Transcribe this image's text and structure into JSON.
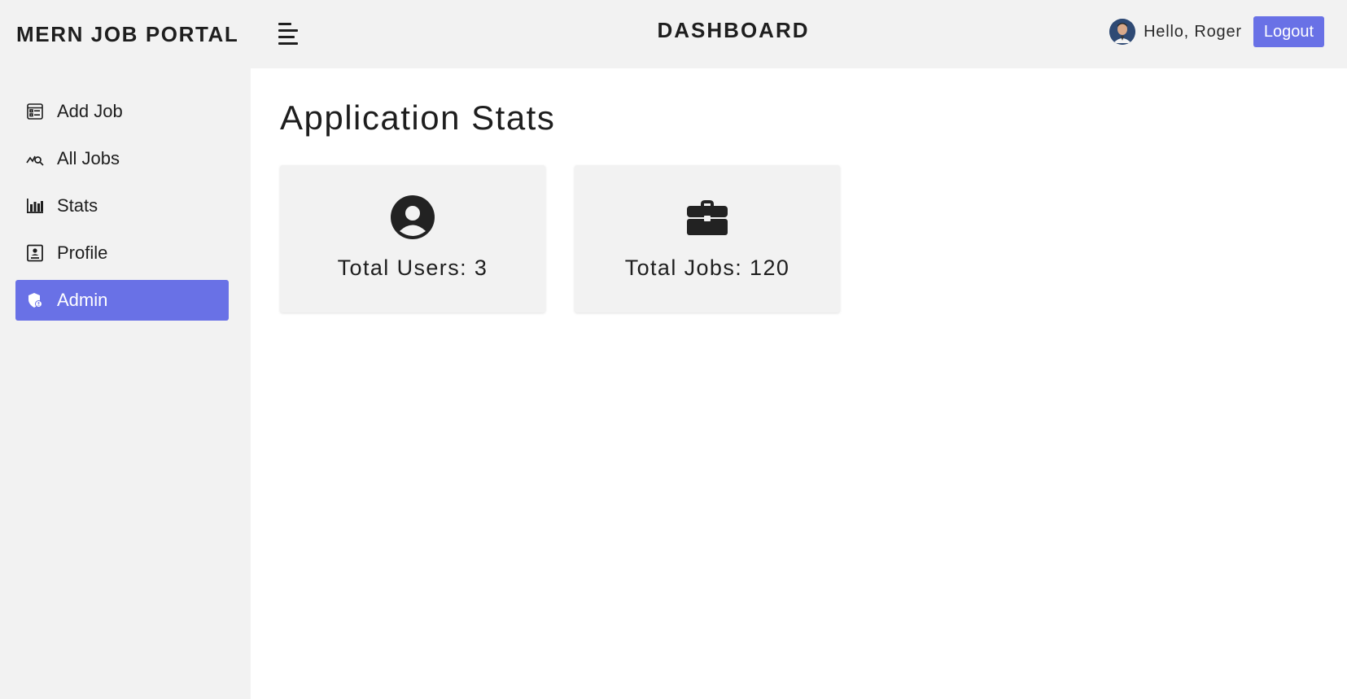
{
  "app": {
    "brand": "MERN JOB PORTAL"
  },
  "navbar": {
    "title": "DASHBOARD",
    "greeting": "Hello, Roger",
    "logout_label": "Logout"
  },
  "sidebar": {
    "items": [
      {
        "label": "Add Job",
        "icon": "form-icon"
      },
      {
        "label": "All Jobs",
        "icon": "chart-search-icon"
      },
      {
        "label": "Stats",
        "icon": "bar-chart-icon"
      },
      {
        "label": "Profile",
        "icon": "profile-card-icon"
      },
      {
        "label": "Admin",
        "icon": "admin-shield-icon",
        "active": true
      }
    ]
  },
  "main": {
    "title": "Application Stats",
    "cards": [
      {
        "label": "Total Users: 3",
        "icon": "user-circle-icon"
      },
      {
        "label": "Total Jobs: 120",
        "icon": "briefcase-icon"
      }
    ]
  },
  "colors": {
    "accent": "#6971e6",
    "background": "#f2f2f2",
    "content": "#ffffff"
  }
}
